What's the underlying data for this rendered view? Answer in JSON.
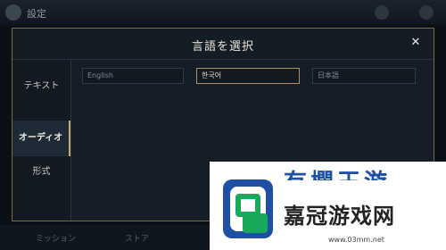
{
  "background": {
    "title": "設定",
    "bottom_tabs": [
      "ミッション",
      "ストア"
    ]
  },
  "dialog": {
    "title": "言語を選択",
    "close_icon": "close-icon",
    "close_glyph": "✕",
    "sidebar": {
      "items": [
        {
          "label": "テキスト",
          "active": false
        },
        {
          "label": "オーディオ",
          "active": true
        },
        {
          "label": "形式",
          "active": false
        }
      ]
    },
    "languages": [
      {
        "label": "English",
        "selected": false
      },
      {
        "label": "한국어",
        "selected": true
      },
      {
        "label": "日本語",
        "selected": false
      }
    ]
  },
  "watermark": {
    "name_top": "有欄王游",
    "name": "嘉冠游戏网",
    "url": "www.03mm.net",
    "colors": {
      "blue": "#1f4fa3",
      "green": "#1aa85a"
    }
  },
  "colors": {
    "accent_gold": "#c8aa6e",
    "panel_bg": "#141c24",
    "text": "#e9e4d8"
  }
}
